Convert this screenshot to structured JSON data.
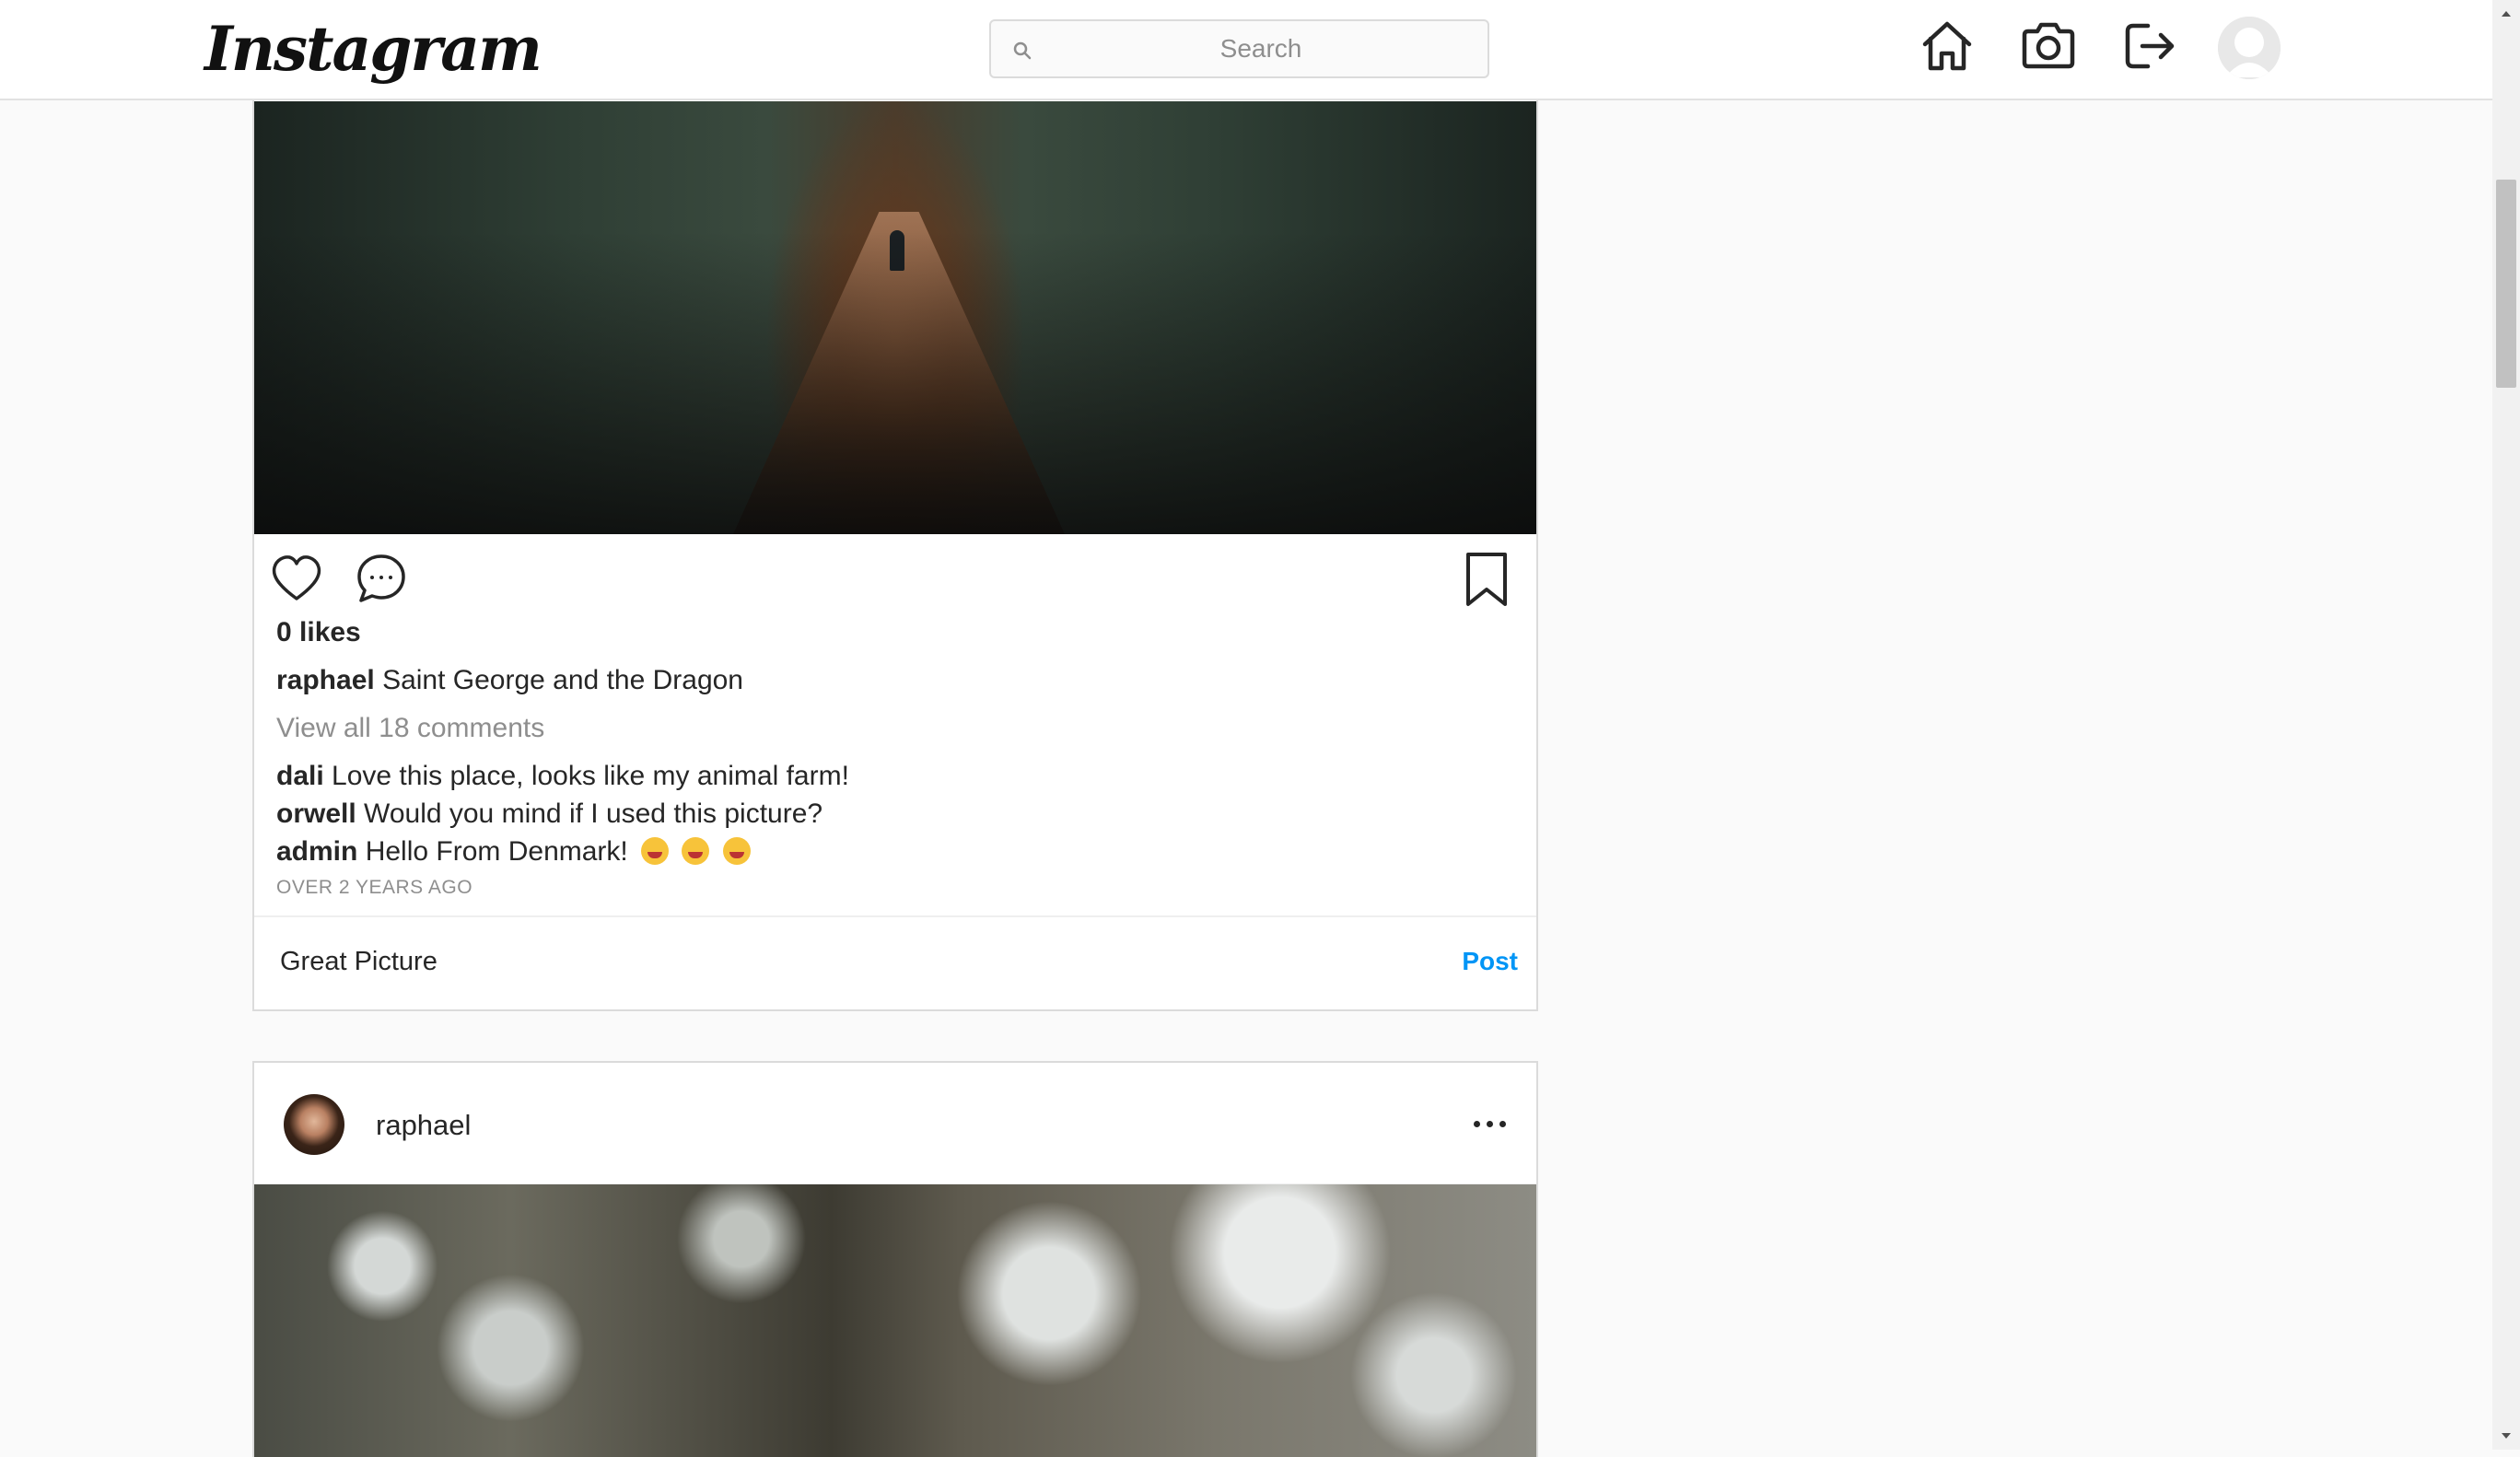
{
  "header": {
    "logo": "Instagram",
    "search_placeholder": "Search",
    "nav": [
      "home-icon",
      "camera-icon",
      "logout-icon",
      "profile-avatar"
    ]
  },
  "posts": [
    {
      "likes": "0 likes",
      "caption_user": "raphael",
      "caption_text": "Saint George and the Dragon",
      "view_all": "View all 18 comments",
      "comments": [
        {
          "user": "dali",
          "text": "Love this place, looks like my animal farm!"
        },
        {
          "user": "orwell",
          "text": "Would you mind if I used this picture?"
        },
        {
          "user": "admin",
          "text": "Hello From Denmark!"
        }
      ],
      "timestamp": "OVER 2 YEARS AGO",
      "comment_input_value": "Great Picture",
      "post_button": "Post"
    },
    {
      "username": "raphael"
    }
  ],
  "colors": {
    "accent": "#0095f6",
    "border": "#dbdbdb",
    "background": "#fafafa",
    "muted": "#8e8e8e"
  }
}
